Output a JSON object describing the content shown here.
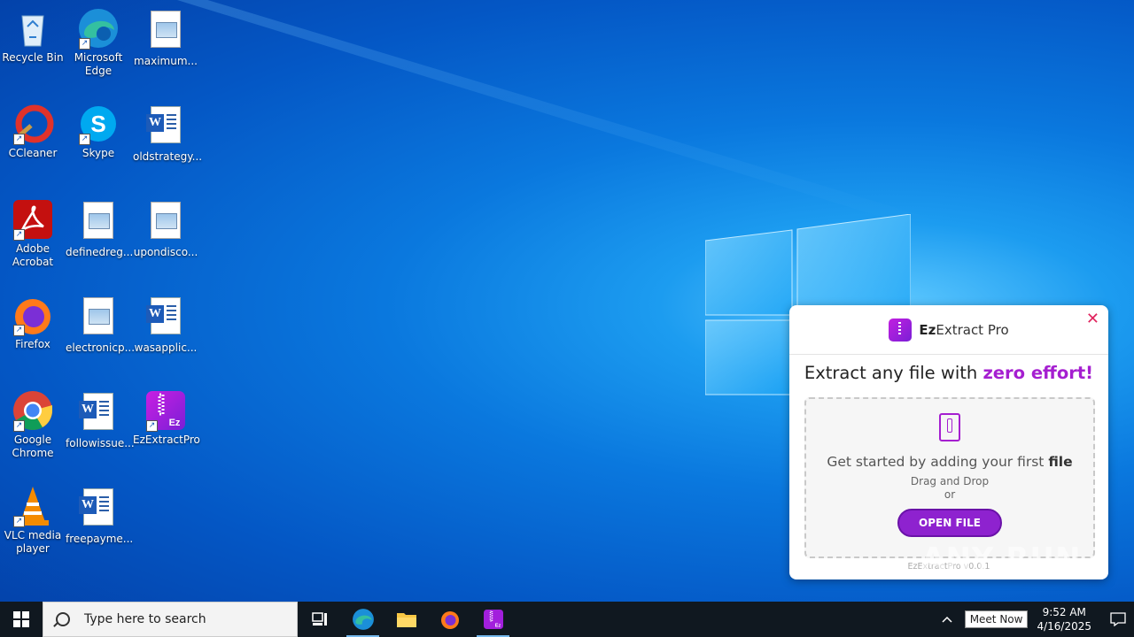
{
  "desktop": {
    "icons": [
      {
        "label": "Recycle Bin"
      },
      {
        "label": "Microsoft Edge"
      },
      {
        "label": "maximum..."
      },
      {
        "label": "CCleaner"
      },
      {
        "label": "Skype"
      },
      {
        "label": "oldstrategy..."
      },
      {
        "label": "Adobe Acrobat"
      },
      {
        "label": "definedreg..."
      },
      {
        "label": "upondisco..."
      },
      {
        "label": "Firefox"
      },
      {
        "label": "electronicp..."
      },
      {
        "label": "wasapplic..."
      },
      {
        "label": "Google Chrome"
      },
      {
        "label": "followissue..."
      },
      {
        "label": "EzExtractPro"
      },
      {
        "label": "VLC media player"
      },
      {
        "label": "freepayme..."
      }
    ]
  },
  "popup": {
    "brand_prefix": "Ez",
    "brand_suffix": "Extract Pro",
    "close_glyph": "✕",
    "headline_plain": "Extract any file with ",
    "headline_emphasis": "zero effort!",
    "prompt_plain": "Get started by adding your first ",
    "prompt_bold": "file",
    "drag_text": "Drag and Drop",
    "or_text": "or",
    "open_button": "OPEN FILE",
    "version": "EzExtractPro v0.0.1"
  },
  "watermark": "ANY RUN",
  "taskbar": {
    "search_placeholder": "Type here to search",
    "meet_now": "Meet Now",
    "time": "9:52 AM",
    "date": "4/16/2025"
  }
}
